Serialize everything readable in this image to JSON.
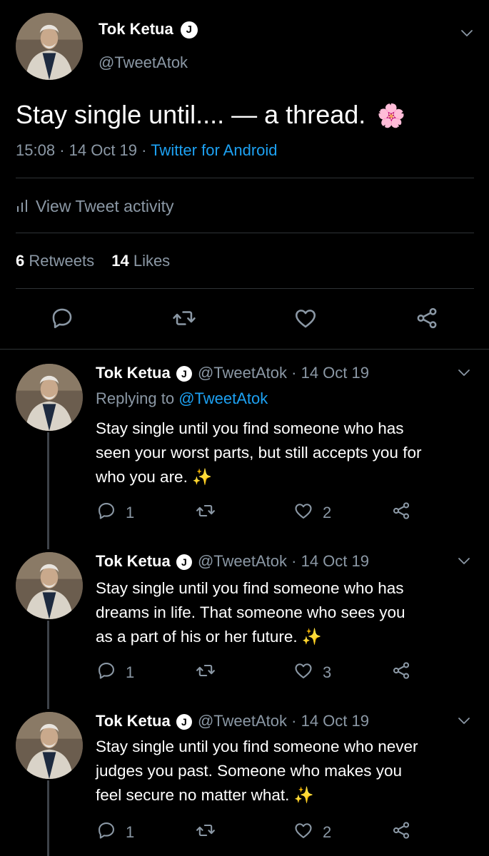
{
  "author": {
    "name": "Tok Ketua",
    "verified_badge": "J",
    "handle": "@TweetAtok"
  },
  "main_tweet": {
    "text": "Stay single until.... — a thread.",
    "emoji": "🌸",
    "time": "15:08",
    "date": "14 Oct 19",
    "source": "Twitter for Android",
    "activity_label": "View Tweet activity",
    "retweets_count": "6",
    "retweets_label": "Retweets",
    "likes_count": "14",
    "likes_label": "Likes"
  },
  "replies": [
    {
      "name": "Tok Ketua",
      "badge": "J",
      "handle": "@TweetAtok",
      "date": "· 14 Oct 19",
      "replying_prefix": "Replying to",
      "replying_handle": "@TweetAtok",
      "lines": [
        "Stay single until you find someone who has",
        "seen your worst parts, but still accepts you for",
        "who you are. ✨"
      ],
      "replies": "1",
      "likes": "2"
    },
    {
      "name": "Tok Ketua",
      "badge": "J",
      "handle": "@TweetAtok",
      "date": "· 14 Oct 19",
      "lines": [
        "Stay single until you find someone who has",
        "dreams in life. That someone who sees you",
        "as a part of his or her future. ✨"
      ],
      "replies": "1",
      "likes": "3"
    },
    {
      "name": "Tok Ketua",
      "badge": "J",
      "handle": "@TweetAtok",
      "date": "· 14 Oct 19",
      "lines": [
        "Stay single until you find someone who never",
        "judges you past. Someone who makes you",
        "feel secure no matter what. ✨"
      ],
      "replies": "1",
      "likes": "2"
    }
  ],
  "icons": {
    "reply": "reply-icon",
    "retweet": "retweet-icon",
    "like": "heart-icon",
    "share": "share-icon",
    "caret": "chevron-down-icon",
    "activity": "bar-chart-icon"
  },
  "colors": {
    "background": "#000000",
    "text": "#ffffff",
    "secondary": "#8b98a5",
    "link": "#1da1f2",
    "divider": "#2f3336"
  }
}
